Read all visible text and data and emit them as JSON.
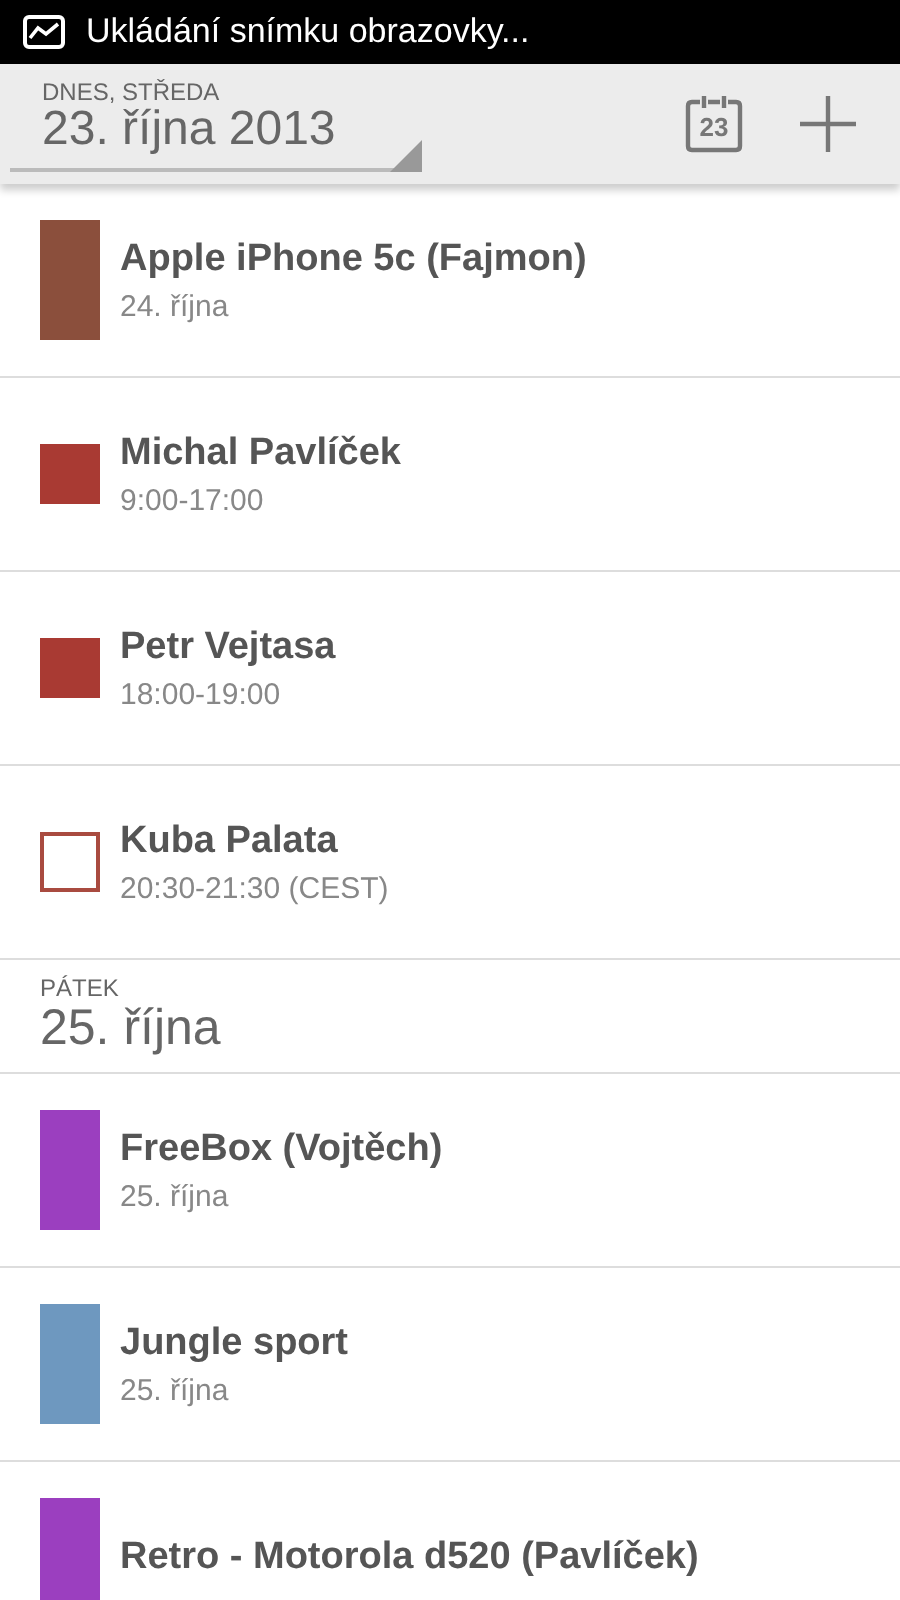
{
  "status_bar": {
    "notification": "Ukládání snímku obrazovky..."
  },
  "toolbar": {
    "day_label": "DNES, STŘEDA",
    "date": "23. října 2013",
    "today_badge": "23"
  },
  "agenda": [
    {
      "kind": "event",
      "title": "Apple iPhone 5c (Fajmon)",
      "subtitle": "24. října",
      "all_day": true,
      "filled": true,
      "color": "#8b4f3c"
    },
    {
      "kind": "event",
      "title": "Michal Pavlíček",
      "subtitle": "9:00-17:00",
      "all_day": false,
      "filled": true,
      "color": "#a93a33"
    },
    {
      "kind": "event",
      "title": "Petr Vejtasa",
      "subtitle": "18:00-19:00",
      "all_day": false,
      "filled": true,
      "color": "#a93a33"
    },
    {
      "kind": "event",
      "title": "Kuba Palata",
      "subtitle": "20:30-21:30 (CEST)",
      "all_day": false,
      "filled": false,
      "color": "#a94b40"
    },
    {
      "kind": "day_header",
      "day_label": "PÁTEK",
      "date": "25. října"
    },
    {
      "kind": "event",
      "title": "FreeBox (Vojtěch)",
      "subtitle": "25. října",
      "all_day": true,
      "filled": true,
      "color": "#9b3fbf"
    },
    {
      "kind": "event",
      "title": "Jungle sport",
      "subtitle": "25. října",
      "all_day": true,
      "filled": true,
      "color": "#6e98bf"
    },
    {
      "kind": "event",
      "title": "Retro - Motorola d520 (Pavlíček)",
      "all_day": true,
      "filled": true,
      "color": "#9b3fbf"
    }
  ]
}
